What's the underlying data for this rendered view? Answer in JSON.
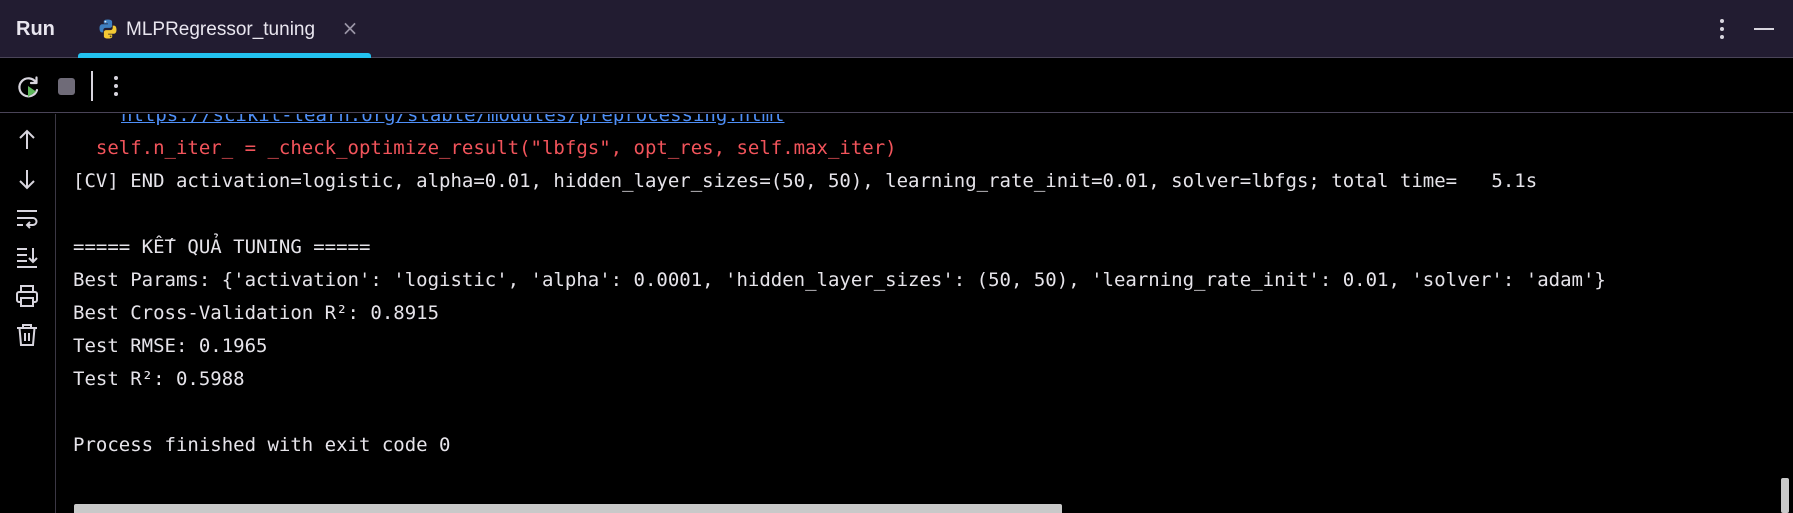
{
  "header": {
    "run_title": "Run",
    "tab": {
      "label": "MLPRegressor_tuning",
      "icon": "python-icon",
      "close_icon": "close-icon"
    },
    "actions": [
      "more-vertical-icon",
      "minimize-icon"
    ],
    "accent_color": "#23c2f0",
    "background_color": "#221c31"
  },
  "toolbar": {
    "icons": [
      "rerun-icon",
      "stop-icon",
      "more-vertical-icon"
    ]
  },
  "gutter": {
    "icons": [
      "arrow-up-icon",
      "arrow-down-icon",
      "soft-wrap-icon",
      "scroll-to-end-icon",
      "print-icon",
      "trash-icon"
    ]
  },
  "console": {
    "lines": [
      {
        "kind": "link",
        "text": "https://scikit-learn.org/stable/modules/preprocessing.html"
      },
      {
        "kind": "error",
        "text": "  self.n_iter_ = _check_optimize_result(\"lbfgs\", opt_res, self.max_iter)"
      },
      {
        "kind": "normal",
        "text": "[CV] END activation=logistic, alpha=0.01, hidden_layer_sizes=(50, 50), learning_rate_init=0.01, solver=lbfgs; total time=   5.1s"
      },
      {
        "kind": "normal",
        "text": ""
      },
      {
        "kind": "normal",
        "text": "===== KẾT QUẢ TUNING ====="
      },
      {
        "kind": "normal",
        "text": "Best Params: {'activation': 'logistic', 'alpha': 0.0001, 'hidden_layer_sizes': (50, 50), 'learning_rate_init': 0.01, 'solver': 'adam'}"
      },
      {
        "kind": "normal",
        "text": "Best Cross-Validation R²: 0.8915"
      },
      {
        "kind": "normal",
        "text": "Test RMSE: 0.1965"
      },
      {
        "kind": "normal",
        "text": "Test R²: 0.5988"
      },
      {
        "kind": "normal",
        "text": ""
      },
      {
        "kind": "normal",
        "text": "Process finished with exit code 0"
      }
    ],
    "colors": {
      "normal": "#e6e4ea",
      "error": "#f2545b",
      "link": "#4f8ff7"
    }
  }
}
